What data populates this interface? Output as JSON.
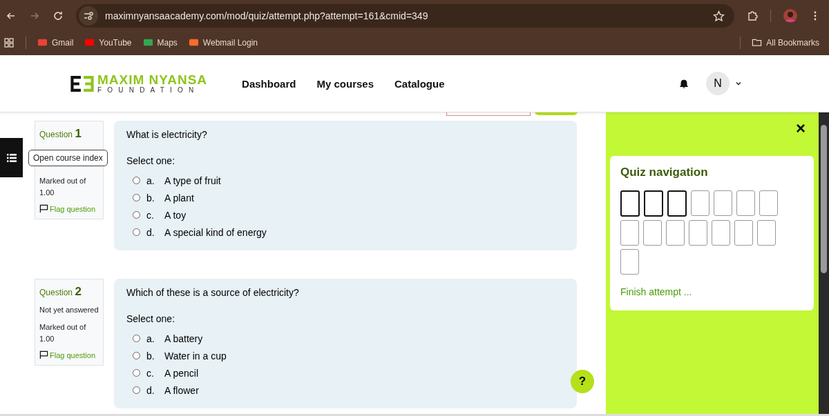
{
  "browser": {
    "url": "maximnyansaacademy.com/mod/quiz/attempt.php?attempt=161&cmid=349",
    "bookmarks": [
      {
        "label": "Gmail",
        "kind": "gmail"
      },
      {
        "label": "YouTube",
        "kind": "youtube"
      },
      {
        "label": "Maps",
        "kind": "maps"
      },
      {
        "label": "Webmail Login",
        "kind": "cpanel"
      }
    ],
    "all_bookmarks": "All Bookmarks"
  },
  "header": {
    "logo_main": "MAXIM NYANSA",
    "logo_sub": "FOUNDATION",
    "nav": [
      "Dashboard",
      "My courses",
      "Catalogue"
    ],
    "avatar": "N"
  },
  "course_index_tooltip": "Open course index",
  "questions": [
    {
      "label": "Question",
      "number": "1",
      "marked": "Marked out of 1.00",
      "flag": "Flag question",
      "text": "What is electricity?",
      "prompt": "Select one:",
      "options": [
        {
          "letter": "a.",
          "text": "A type of fruit",
          "selected": false
        },
        {
          "letter": "b.",
          "text": "A plant",
          "selected": false
        },
        {
          "letter": "c.",
          "text": "A toy",
          "selected": false
        },
        {
          "letter": "d.",
          "text": "A special kind of energy",
          "selected": false
        }
      ]
    },
    {
      "label": "Question",
      "number": "2",
      "status": "Not yet answered",
      "marked": "Marked out of 1.00",
      "flag": "Flag question",
      "text": "Which of these is a source of electricity?",
      "prompt": "Select one:",
      "options": [
        {
          "letter": "a.",
          "text": "A battery",
          "selected": false
        },
        {
          "letter": "b.",
          "text": "Water in a cup",
          "selected": false
        },
        {
          "letter": "c.",
          "text": "A pencil",
          "selected": false
        },
        {
          "letter": "d.",
          "text": "A flower",
          "selected": false
        }
      ]
    }
  ],
  "quiz_nav": {
    "close": "×",
    "title": "Quiz navigation",
    "buttons": [
      {
        "selected": true
      },
      {
        "selected": true
      },
      {
        "selected": true
      },
      {
        "selected": false
      },
      {
        "selected": false
      },
      {
        "selected": false
      },
      {
        "selected": false
      },
      {
        "selected": false
      },
      {
        "selected": false
      },
      {
        "selected": false
      },
      {
        "selected": false
      },
      {
        "selected": false
      },
      {
        "selected": false
      },
      {
        "selected": false
      },
      {
        "selected": false
      }
    ],
    "finish": "Finish attempt ..."
  },
  "help": "?"
}
